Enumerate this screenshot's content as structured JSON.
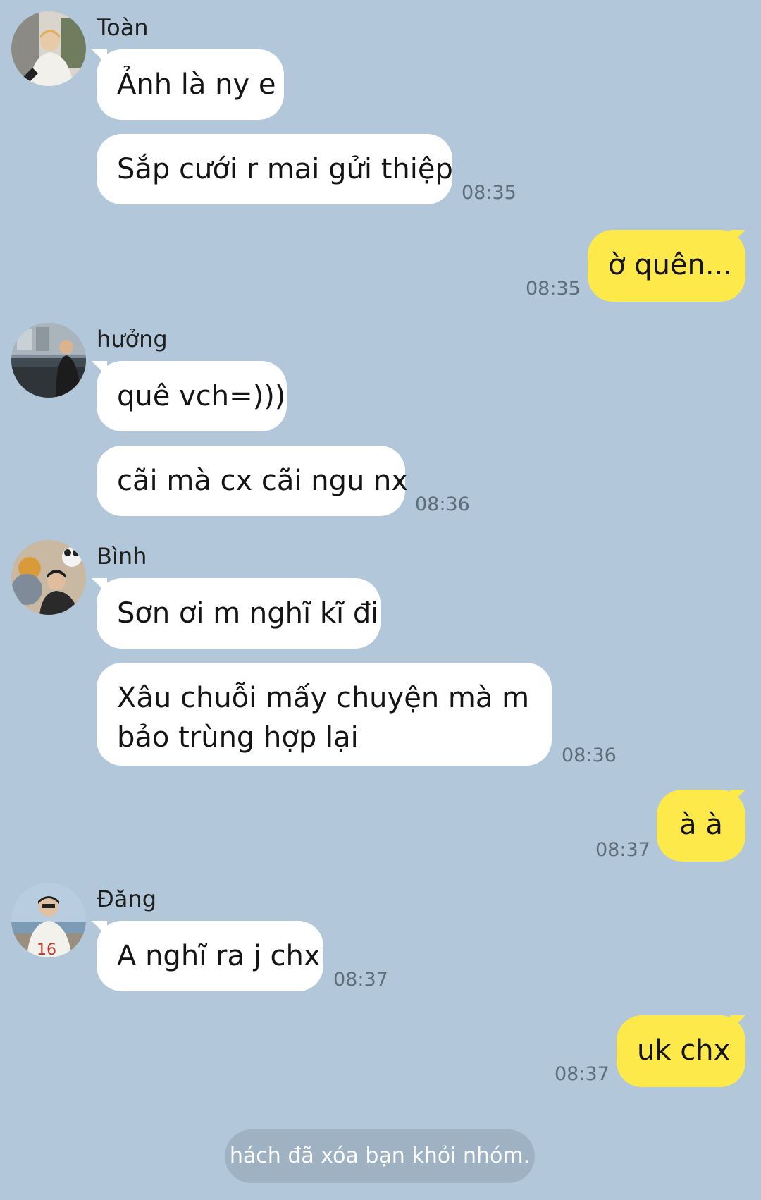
{
  "messages": [
    {
      "sender": "Toàn",
      "texts": [
        "Ảnh là ny e",
        "Sắp cưới r mai gửi thiệp"
      ],
      "time": "08:35"
    },
    {
      "self": true,
      "text": "ờ quên...",
      "time": "08:35"
    },
    {
      "sender": "hưởng",
      "texts": [
        "quê vch=)))",
        "cãi mà cx cãi ngu nx"
      ],
      "time": "08:36"
    },
    {
      "sender": "Bình",
      "texts": [
        "Sơn ơi m nghĩ kĩ đi",
        "Xâu chuỗi mấy chuyện mà m bảo trùng hợp lại"
      ],
      "time": "08:36"
    },
    {
      "self": true,
      "text": "à à",
      "time": "08:37"
    },
    {
      "sender": "Đăng",
      "texts": [
        "A nghĩ ra j chx"
      ],
      "time": "08:37"
    },
    {
      "self": true,
      "text": "uk chx",
      "time": "08:37"
    }
  ],
  "system_notice": "hách đã xóa bạn khỏi nhóm.",
  "colors": {
    "background": "#b2c7d9",
    "incoming_bubble": "#ffffff",
    "outgoing_bubble": "#fee94a",
    "timestamp": "#5e6d7b",
    "notice_bg": "#9fb2c4"
  },
  "icons": [
    "avatar-toan",
    "avatar-huong",
    "avatar-binh",
    "avatar-dang"
  ]
}
